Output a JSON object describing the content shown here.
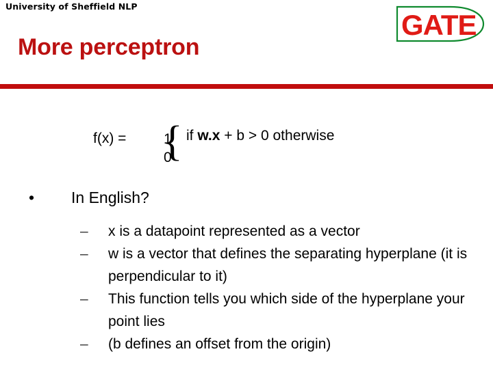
{
  "slide": {
    "org_line": "University of Sheffield NLP",
    "title": "More perceptron",
    "accent_red": "#c10d0d",
    "title_red": "#bb1111",
    "logo_green": "#0f8a2e"
  },
  "logo": {
    "text": "GATE",
    "shape": "gate-d-outline"
  },
  "formula": {
    "lhs": "f(x) =",
    "brace": "{",
    "case_values": [
      "1",
      "0"
    ],
    "cases": [
      {
        "prefix": "if ",
        "vector": "w.x",
        "suffix": " + b > 0"
      },
      {
        "prefix": "otherwise",
        "vector": "",
        "suffix": ""
      }
    ]
  },
  "body": {
    "bullet_marker": "•",
    "bullet": "In English?",
    "sub_marker": "–",
    "sub_items": [
      "x is a datapoint represented as a vector",
      "w is a vector that defines the separating hyperplane (it is perpendicular to it)",
      "This function tells you which side of the hyperplane your point lies",
      "(b defines an offset from the origin)"
    ]
  }
}
